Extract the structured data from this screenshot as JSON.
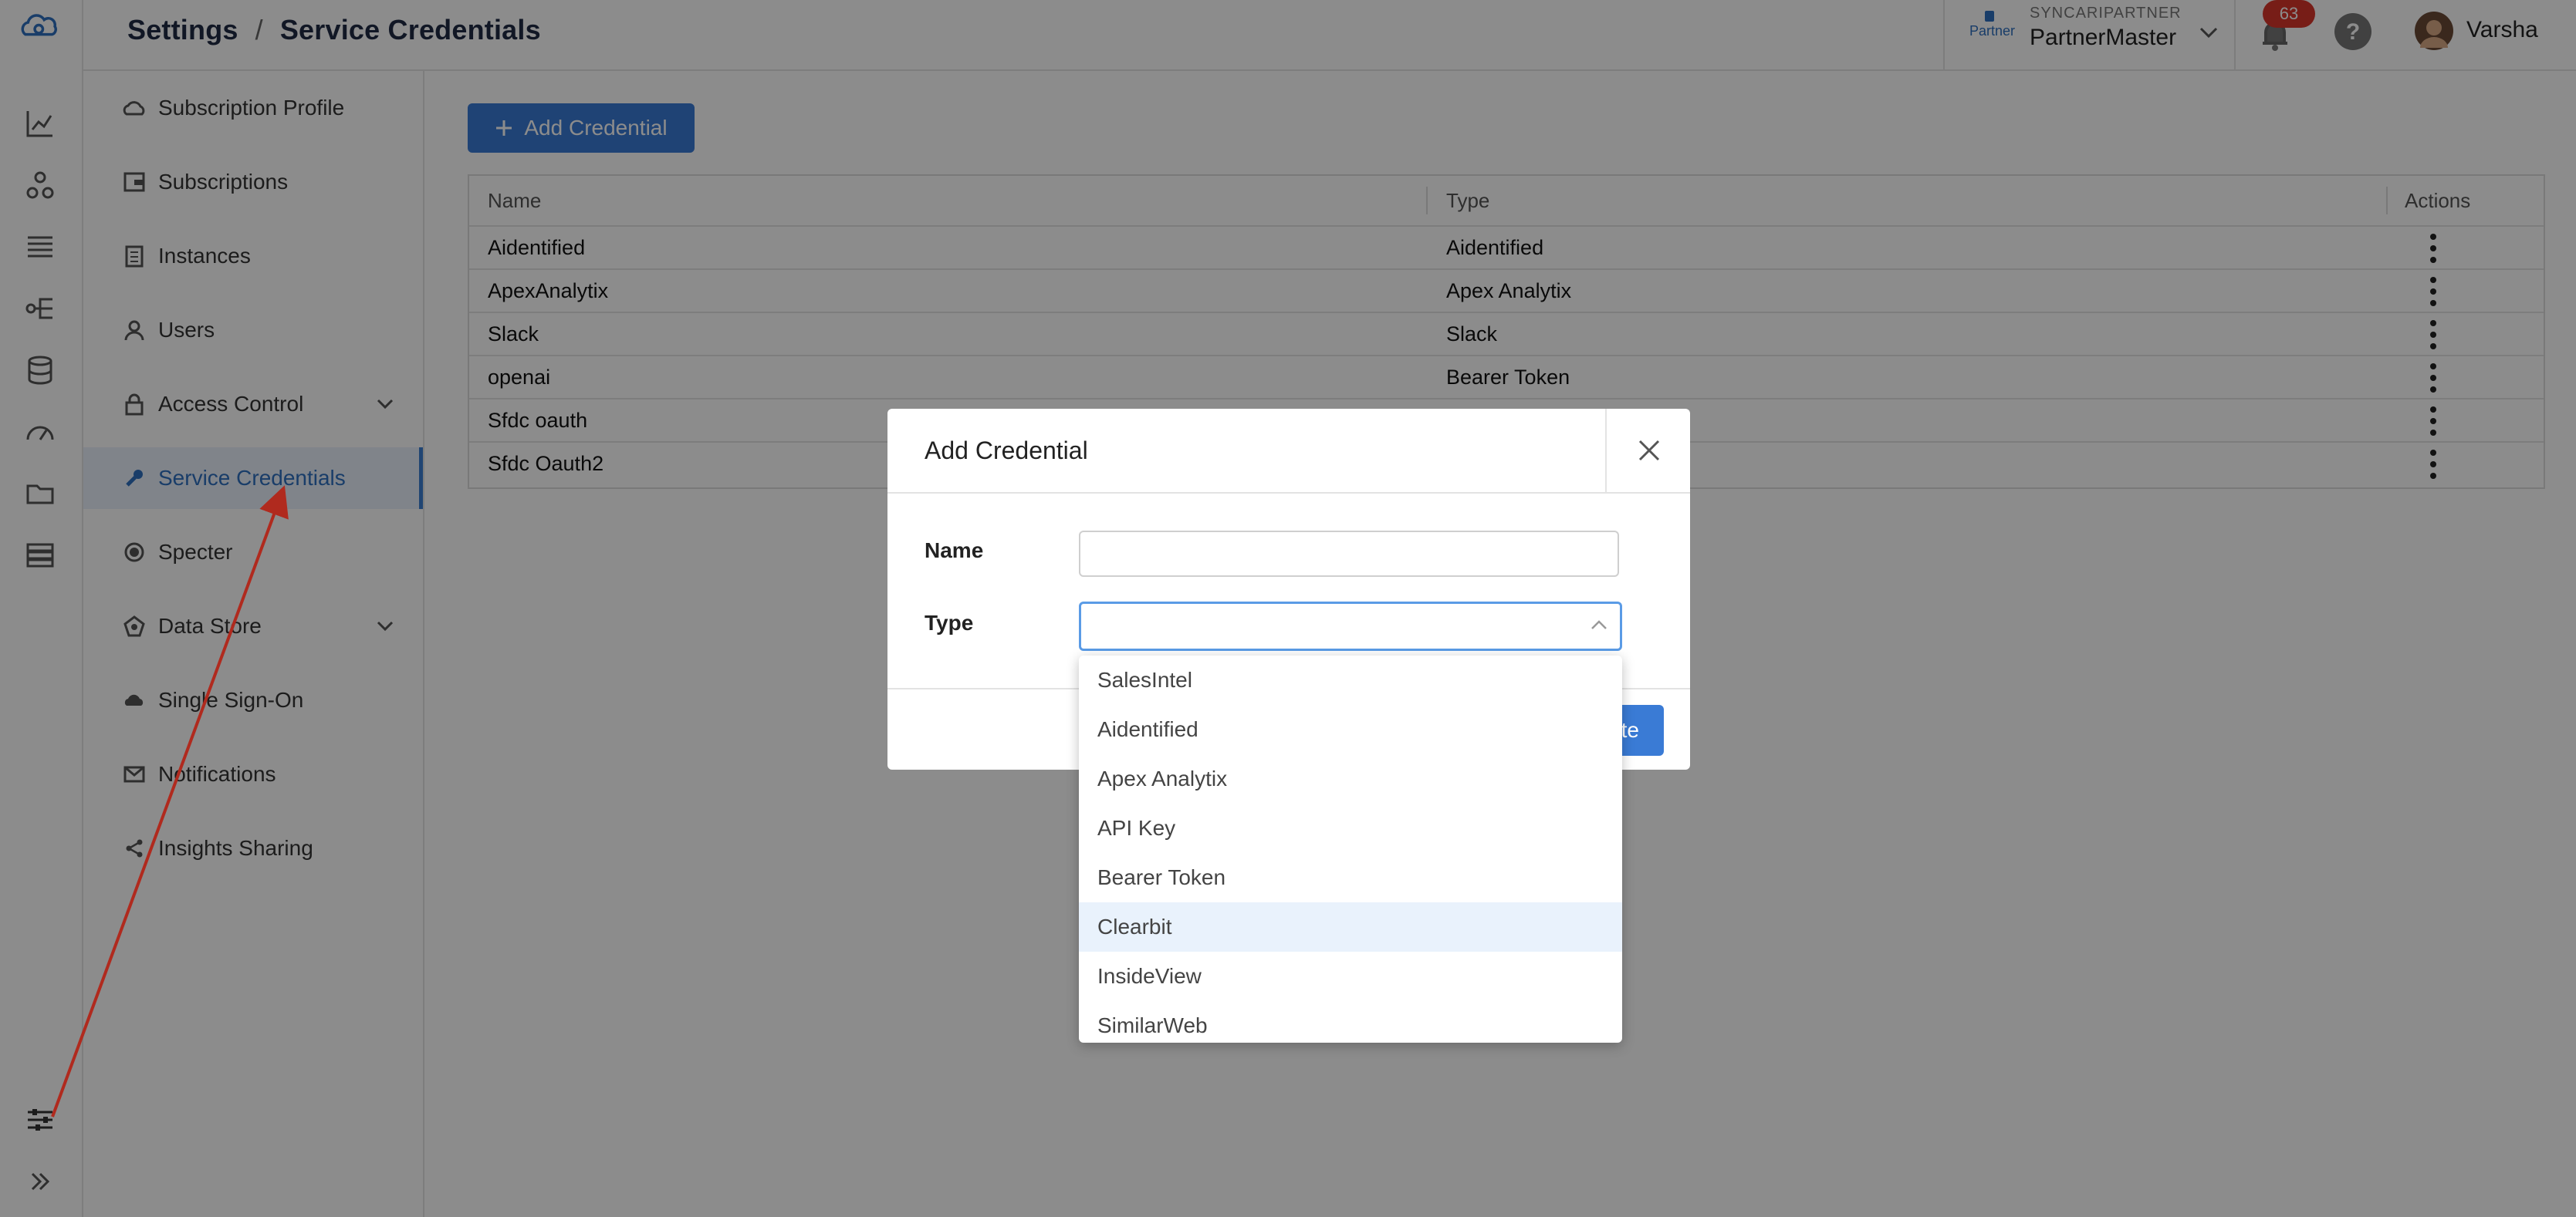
{
  "header": {
    "breadcrumb_root": "Settings",
    "breadcrumb_sep": "/",
    "breadcrumb_current": "Service Credentials",
    "partner_label": "Partner",
    "org_name": "SYNCARIPARTNER",
    "org_sub": "PartnerMaster",
    "notification_count": "63",
    "user_name": "Varsha"
  },
  "sidebar": {
    "items": [
      {
        "label": "Subscription Profile",
        "icon": "cloud-icon"
      },
      {
        "label": "Subscriptions",
        "icon": "wallet-icon"
      },
      {
        "label": "Instances",
        "icon": "building-icon"
      },
      {
        "label": "Users",
        "icon": "user-icon"
      },
      {
        "label": "Access Control",
        "icon": "lock-icon"
      },
      {
        "label": "Service Credentials",
        "icon": "wrench-icon"
      },
      {
        "label": "Specter",
        "icon": "spiral-icon"
      },
      {
        "label": "Data Store",
        "icon": "datastore-icon"
      },
      {
        "label": "Single Sign-On",
        "icon": "cloud-login-icon"
      },
      {
        "label": "Notifications",
        "icon": "mail-icon"
      },
      {
        "label": "Insights Sharing",
        "icon": "share-icon"
      }
    ]
  },
  "main": {
    "add_button_label": "Add Credential",
    "table": {
      "columns": [
        "Name",
        "Type",
        "Actions"
      ],
      "rows": [
        {
          "name": "Aidentified",
          "type": "Aidentified"
        },
        {
          "name": "ApexAnalytix",
          "type": "Apex Analytix"
        },
        {
          "name": "Slack",
          "type": "Slack"
        },
        {
          "name": "openai",
          "type": "Bearer Token"
        },
        {
          "name": "Sfdc oauth",
          "type": ""
        },
        {
          "name": "Sfdc Oauth2",
          "type": ""
        }
      ]
    }
  },
  "modal": {
    "title": "Add Credential",
    "name_label": "Name",
    "name_value": "",
    "type_label": "Type",
    "create_label": "Create",
    "type_options": [
      "SalesIntel",
      "Aidentified",
      "Apex Analytix",
      "API Key",
      "Bearer Token",
      "Clearbit",
      "InsideView",
      "SimilarWeb"
    ],
    "highlighted_option": "Clearbit"
  },
  "colors": {
    "accent": "#3a7bd5",
    "annotation_arrow": "#b02a1e",
    "badge": "#d9362b"
  }
}
